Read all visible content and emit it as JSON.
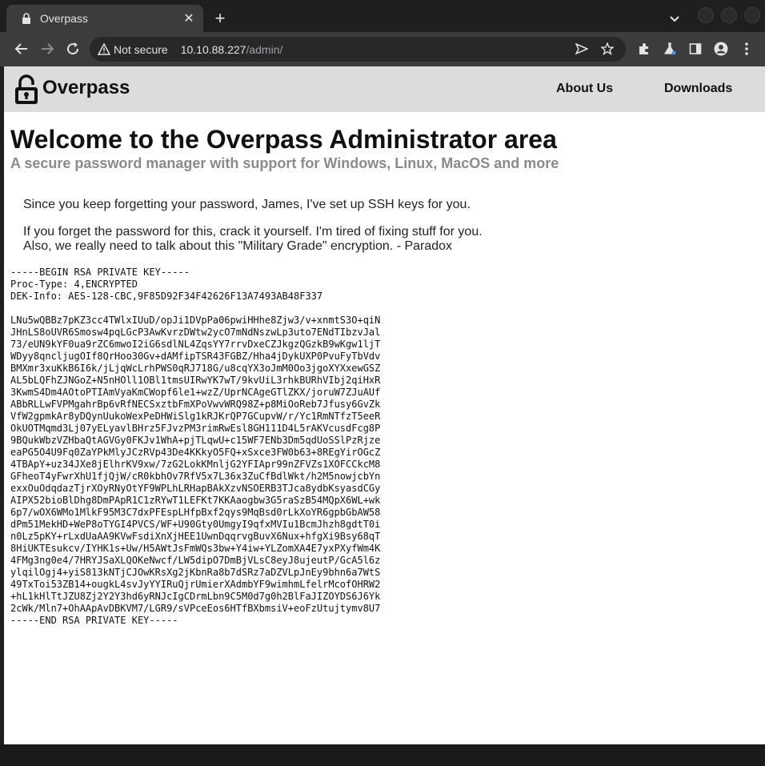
{
  "browser": {
    "tab_title": "Overpass",
    "tab_icon": "lock-icon",
    "security_label": "Not secure",
    "url_host": "10.10.88.227",
    "url_path": "/admin/"
  },
  "site": {
    "brand": "Overpass",
    "nav": [
      "About Us",
      "Downloads"
    ],
    "title": "Welcome to the Overpass Administrator area",
    "subtitle": "A secure password manager with support for Windows, Linux, MacOS and more",
    "message": [
      "Since you keep forgetting your password, James, I've set up SSH keys for you.",
      "If you forget the password for this, crack it yourself. I'm tired of fixing stuff for you.",
      "Also, we really need to talk about this \"Military Grade\" encryption. - Paradox"
    ],
    "private_key": "-----BEGIN RSA PRIVATE KEY-----\nProc-Type: 4,ENCRYPTED\nDEK-Info: AES-128-CBC,9F85D92F34F42626F13A7493AB48F337\n\nLNu5wQBBz7pKZ3cc4TWlxIUuD/opJi1DVpPa06pwiHHhe8Zjw3/v+xnmtS3O+qiN\nJHnLS8oUVR6Smosw4pqLGcP3AwKvrzDWtw2ycO7mNdNszwLp3uto7ENdTIbzvJal\n73/eUN9kYF0ua9rZC6mwoI2iG6sdlNL4ZqsYY7rrvDxeCZJkgzQGzkB9wKgw1ljT\nWDyy8qncljugOIf8QrHoo30Gv+dAMfipTSR43FGBZ/Hha4jDykUXP0PvuFyTbVdv\nBMXmr3xuKkB6I6k/jLjqWcLrhPWS0qRJ718G/u8cqYX3oJmM0Oo3jgoXYXxewGSZ\nAL5bLQFhZJNGoZ+N5nHOll1OBl1tmsUIRwYK7wT/9kvUiL3rhkBURhVIbj2qiHxR\n3KwmS4Dm4AOtoPTIAmVyaKmCWopf6le1+wzZ/UprNCAgeGTlZKX/joruW7ZJuAUf\nABbRLLwFVPMgahrBp6vRfNECSxztbFmXPoVwvWRQ98Z+p8MiOoReb7Jfusy6GvZk\nVfW2gpmkAr8yDQynUukoWexPeDHWiSlg1kRJKrQP7GCupvW/r/Yc1RmNTfzT5eeR\nOkUOTMqmd3Lj07yELyavlBHrz5FJvzPM3rimRwEsl8GH111D4L5rAKVcusdFcg8P\n9BQukWbzVZHbaQtAGVGy0FKJv1WhA+pjTLqwU+c15WF7ENb3Dm5qdUoSSlPzRjze\neaPG5O4U9Fq0ZaYPkMlyJCzRVp43De4KKkyO5FQ+xSxce3FW0b63+8REgYirOGcZ\n4TBApY+uz34JXe8jElhrKV9xw/7zG2LokKMnljG2YFIApr99nZFVZs1XOFCCkcM8\nGFheoT4yFwrXhU1fjQjW/cR0kbhOv7RfV5x7L36x3ZuCfBdlWkt/h2M5nowjcbYn\nexxOuOdqdazTjrXOyRNyOtYF9WPLhLRHapBAkXzvNSOERB3TJca8ydbKsyasdCGy\nAIPX52bioBlDhg8DmPApR1C1zRYwT1LEFKt7KKAaogbw3G5raSzB54MQpX6WL+wk\n6p7/wOX6WMo1MlkF95M3C7dxPFEspLHfpBxf2qys9MqBsd0rLkXoYR6gpbGbAW58\ndPm51MekHD+WeP8oTYGI4PVCS/WF+U90Gty0UmgyI9qfxMVIu1BcmJhzh8gdtT0i\nn0Lz5pKY+rLxdUaAA9KVwFsdiXnXjHEE1UwnDqqrvgBuvX6Nux+hfgXi9Bsy68qT\n8HiUKTEsukcv/IYHK1s+Uw/H5AWtJsFmWQs3bw+Y4iw+YLZomXA4E7yxPXyfWm4K\n4FMg3ng0e4/7HRYJSaXLQOKeNwcf/LW5dipO7DmBjVLsC8eyJ8ujeutP/GcA5l6z\nylqilOgj4+yiS813kNTjCJOwKRsXg2jKbnRa8b7dSRz7aDZVLpJnEy9bhn6a7WtS\n49TxToi53ZB14+ougkL4svJyYYIRuQjrUmierXAdmbYF9wimhmLfelrMcofOHRW2\n+hL1kHlTtJZU8Zj2Y2Y3hd6yRNJcIgCDrmLbn9C5M0d7g0h2BlFaJIZOYDS6J6Yk\n2cWk/Mln7+OhAApAvDBKVM7/LGR9/sVPceEos6HTfBXbmsiV+eoFzUtujtymv8U7\n-----END RSA PRIVATE KEY-----"
  }
}
